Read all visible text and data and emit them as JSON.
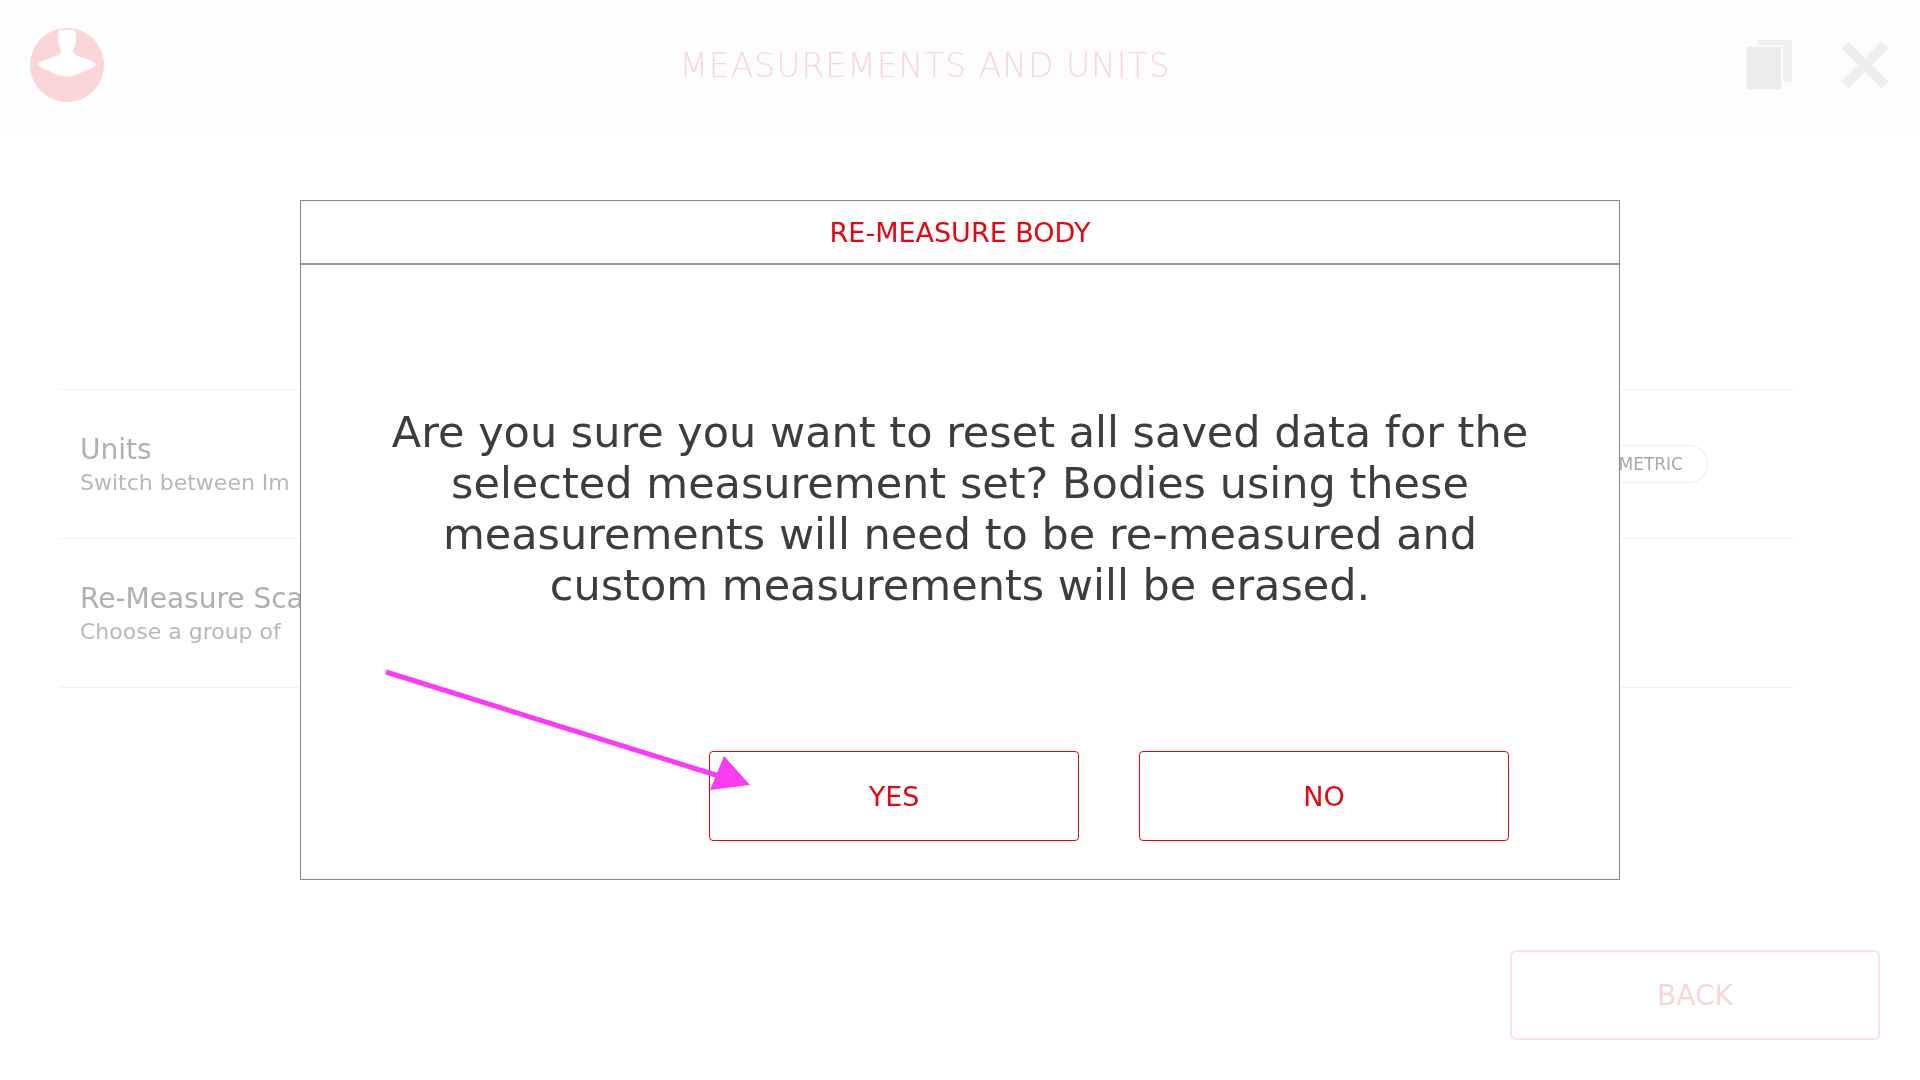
{
  "header": {
    "title": "MEASUREMENTS AND UNITS"
  },
  "settings": [
    {
      "title": "Units",
      "subtitle": "Switch between Im",
      "control": {
        "kind": "pill",
        "label": "METRIC"
      }
    },
    {
      "title": "Re-Measure Sca",
      "subtitle": "Choose a group of"
    }
  ],
  "back_button": "BACK",
  "dialog": {
    "title": "RE-MEASURE BODY",
    "message": "Are you sure you want to reset all saved data for the selected measurement set? Bodies using these measurements will need to be re-measured and custom measurements will be erased.",
    "buttons": [
      "YES",
      "NO"
    ]
  }
}
